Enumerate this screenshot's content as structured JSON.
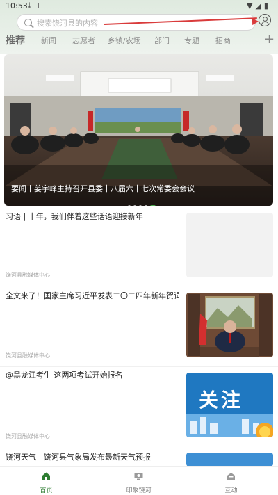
{
  "status_bar": {
    "time": "10:53",
    "icons": "▼◢▮"
  },
  "search": {
    "placeholder": "搜索饶河县的内容"
  },
  "tabs": [
    {
      "label": "推荐",
      "active": true
    },
    {
      "label": "新闻"
    },
    {
      "label": "志愿者"
    },
    {
      "label": "乡镇/农场"
    },
    {
      "label": "部门"
    },
    {
      "label": "专题"
    },
    {
      "label": "招商"
    }
  ],
  "tab_add_label": "+",
  "banner": {
    "caption": "要闻丨姜宇峰主持召开县委十八届六十七次常委会会议",
    "dot_count": 5,
    "active_dot": 4
  },
  "news": [
    {
      "title": "习语 | 十年，我们伴着这些话语迎接新年",
      "source": "饶河县融媒体中心",
      "thumb": "blank"
    },
    {
      "title": "全文来了！国家主席习近平发表二〇二四年新年贺词",
      "source": "饶河县融媒体中心",
      "thumb": "portrait"
    },
    {
      "title": "@黑龙江考生 这两项考试开始报名",
      "source": "饶河县融媒体中心",
      "thumb": "attention",
      "thumb_text": "关注"
    },
    {
      "title": "饶河天气丨饶河县气象局发布最新天气预报",
      "source": "",
      "thumb": "weather"
    }
  ],
  "bottom_nav": [
    {
      "label": "首页",
      "icon": "home-icon",
      "active": true
    },
    {
      "label": "印象饶河",
      "icon": "impression-icon"
    },
    {
      "label": "互动",
      "icon": "interaction-icon"
    }
  ],
  "colors": {
    "accent": "#2e7d32",
    "arrow": "#d93b3b"
  }
}
